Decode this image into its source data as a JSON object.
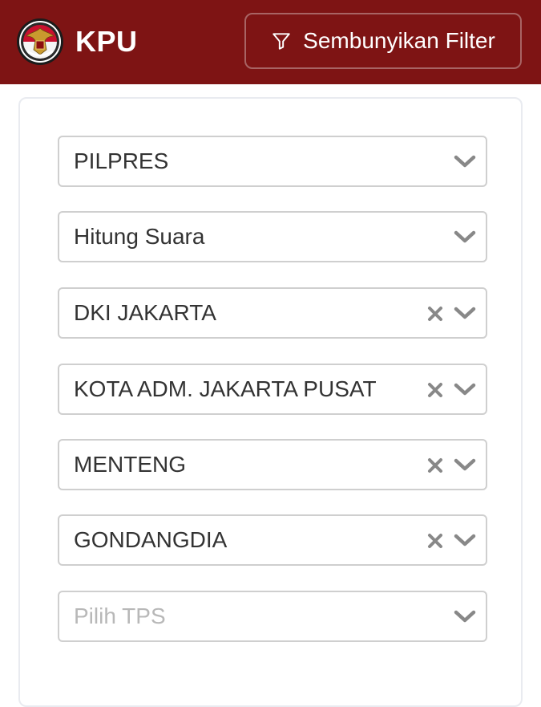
{
  "header": {
    "brand": "KPU",
    "filter_toggle_label": "Sembunyikan Filter",
    "colors": {
      "background": "#7e1414",
      "text": "#ffffff"
    }
  },
  "filters": [
    {
      "value": "PILPRES",
      "clearable": false,
      "placeholder": false
    },
    {
      "value": "Hitung Suara",
      "clearable": false,
      "placeholder": false
    },
    {
      "value": "DKI JAKARTA",
      "clearable": true,
      "placeholder": false
    },
    {
      "value": "KOTA ADM. JAKARTA PUSAT",
      "clearable": true,
      "placeholder": false
    },
    {
      "value": "MENTENG",
      "clearable": true,
      "placeholder": false
    },
    {
      "value": "GONDANGDIA",
      "clearable": true,
      "placeholder": false
    },
    {
      "value": "Pilih TPS",
      "clearable": false,
      "placeholder": true
    }
  ],
  "icons": {
    "logo": "kpu-garuda-logo-icon",
    "filter": "filter-funnel-icon",
    "clear": "close-x-icon",
    "dropdown": "chevron-down-icon"
  }
}
